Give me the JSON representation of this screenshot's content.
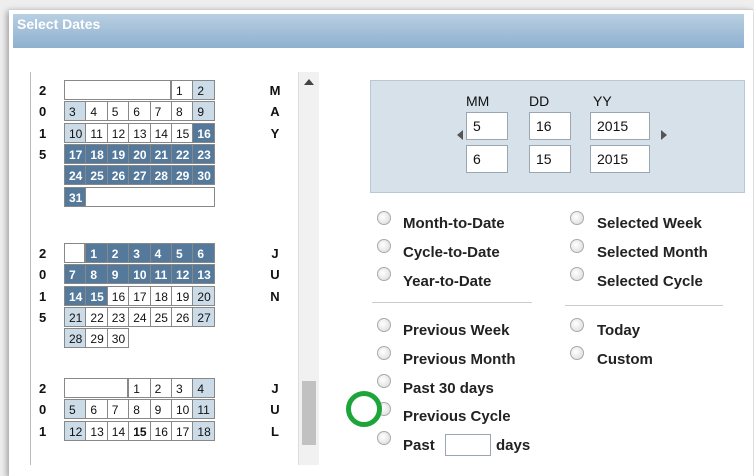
{
  "header": {
    "title": "Select Dates"
  },
  "calendar": {
    "months": [
      {
        "year_digits": [
          "2",
          "0",
          "1",
          "5"
        ],
        "letters": [
          "M",
          "A",
          "Y"
        ],
        "rows": [
          {
            "offset": 5,
            "cells": [
              {
                "v": "1",
                "t": "n"
              },
              {
                "v": "2",
                "t": "l"
              }
            ]
          },
          {
            "offset": 0,
            "cells": [
              {
                "v": "3",
                "t": "l"
              },
              {
                "v": "4",
                "t": "n"
              },
              {
                "v": "5",
                "t": "n"
              },
              {
                "v": "6",
                "t": "n"
              },
              {
                "v": "7",
                "t": "n"
              },
              {
                "v": "8",
                "t": "n"
              },
              {
                "v": "9",
                "t": "l"
              }
            ]
          },
          {
            "offset": 0,
            "cells": [
              {
                "v": "10",
                "t": "l"
              },
              {
                "v": "11",
                "t": "n"
              },
              {
                "v": "12",
                "t": "n"
              },
              {
                "v": "13",
                "t": "n"
              },
              {
                "v": "14",
                "t": "n"
              },
              {
                "v": "15",
                "t": "n"
              },
              {
                "v": "16",
                "t": "s"
              }
            ]
          },
          {
            "offset": 0,
            "cells": [
              {
                "v": "17",
                "t": "s"
              },
              {
                "v": "18",
                "t": "s"
              },
              {
                "v": "19",
                "t": "s"
              },
              {
                "v": "20",
                "t": "s"
              },
              {
                "v": "21",
                "t": "s"
              },
              {
                "v": "22",
                "t": "s"
              },
              {
                "v": "23",
                "t": "s"
              }
            ]
          },
          {
            "offset": 0,
            "cells": [
              {
                "v": "24",
                "t": "s"
              },
              {
                "v": "25",
                "t": "s"
              },
              {
                "v": "26",
                "t": "s"
              },
              {
                "v": "27",
                "t": "s"
              },
              {
                "v": "28",
                "t": "s"
              },
              {
                "v": "29",
                "t": "s"
              },
              {
                "v": "30",
                "t": "s"
              }
            ]
          },
          {
            "offset": 0,
            "trail": true,
            "cells": [
              {
                "v": "31",
                "t": "s"
              }
            ]
          }
        ]
      },
      {
        "year_digits": [
          "2",
          "0",
          "1",
          "5"
        ],
        "letters": [
          "J",
          "U",
          "N"
        ],
        "rows": [
          {
            "offset": 1,
            "cells": [
              {
                "v": "1",
                "t": "s"
              },
              {
                "v": "2",
                "t": "s"
              },
              {
                "v": "3",
                "t": "s"
              },
              {
                "v": "4",
                "t": "s"
              },
              {
                "v": "5",
                "t": "s"
              },
              {
                "v": "6",
                "t": "s"
              }
            ]
          },
          {
            "offset": 0,
            "cells": [
              {
                "v": "7",
                "t": "s"
              },
              {
                "v": "8",
                "t": "s"
              },
              {
                "v": "9",
                "t": "s"
              },
              {
                "v": "10",
                "t": "s"
              },
              {
                "v": "11",
                "t": "s"
              },
              {
                "v": "12",
                "t": "s"
              },
              {
                "v": "13",
                "t": "s"
              }
            ]
          },
          {
            "offset": 0,
            "cells": [
              {
                "v": "14",
                "t": "s"
              },
              {
                "v": "15",
                "t": "s"
              },
              {
                "v": "16",
                "t": "n"
              },
              {
                "v": "17",
                "t": "n"
              },
              {
                "v": "18",
                "t": "n"
              },
              {
                "v": "19",
                "t": "n"
              },
              {
                "v": "20",
                "t": "l"
              }
            ]
          },
          {
            "offset": 0,
            "cells": [
              {
                "v": "21",
                "t": "l"
              },
              {
                "v": "22",
                "t": "n"
              },
              {
                "v": "23",
                "t": "n"
              },
              {
                "v": "24",
                "t": "n"
              },
              {
                "v": "25",
                "t": "n"
              },
              {
                "v": "26",
                "t": "n"
              },
              {
                "v": "27",
                "t": "l"
              }
            ]
          },
          {
            "offset": 0,
            "cells": [
              {
                "v": "28",
                "t": "l"
              },
              {
                "v": "29",
                "t": "n"
              },
              {
                "v": "30",
                "t": "n"
              }
            ]
          }
        ]
      },
      {
        "year_digits": [
          "2",
          "0",
          "1"
        ],
        "letters": [
          "J",
          "U",
          "L"
        ],
        "rows": [
          {
            "offset": 3,
            "cells": [
              {
                "v": "1",
                "t": "n"
              },
              {
                "v": "2",
                "t": "n"
              },
              {
                "v": "3",
                "t": "n"
              },
              {
                "v": "4",
                "t": "l"
              }
            ]
          },
          {
            "offset": 0,
            "cells": [
              {
                "v": "5",
                "t": "l"
              },
              {
                "v": "6",
                "t": "n"
              },
              {
                "v": "7",
                "t": "n"
              },
              {
                "v": "8",
                "t": "n"
              },
              {
                "v": "9",
                "t": "n"
              },
              {
                "v": "10",
                "t": "n"
              },
              {
                "v": "11",
                "t": "l"
              }
            ]
          },
          {
            "offset": 0,
            "cells": [
              {
                "v": "12",
                "t": "l"
              },
              {
                "v": "13",
                "t": "n"
              },
              {
                "v": "14",
                "t": "n"
              },
              {
                "v": "15",
                "t": "b"
              },
              {
                "v": "16",
                "t": "n"
              },
              {
                "v": "17",
                "t": "n"
              },
              {
                "v": "18",
                "t": "l"
              }
            ]
          }
        ]
      }
    ]
  },
  "date_range": {
    "labels": {
      "mm": "MM",
      "dd": "DD",
      "yy": "YY"
    },
    "start": {
      "mm": "5",
      "dd": "16",
      "yy": "2015"
    },
    "end": {
      "mm": "6",
      "dd": "15",
      "yy": "2015"
    }
  },
  "options": {
    "month_to_date": "Month-to-Date",
    "cycle_to_date": "Cycle-to-Date",
    "year_to_date": "Year-to-Date",
    "selected_week": "Selected Week",
    "selected_month": "Selected Month",
    "selected_cycle": "Selected Cycle",
    "previous_week": "Previous Week",
    "previous_month": "Previous Month",
    "past_30_days": "Past 30 days",
    "previous_cycle": "Previous Cycle",
    "past": "Past",
    "days": "days",
    "today": "Today",
    "custom": "Custom"
  },
  "colors": {
    "selected": "#55799b",
    "weekend": "#ccdbe8",
    "header": "#8eb0cf",
    "highlight_ring": "#1ea53a"
  }
}
